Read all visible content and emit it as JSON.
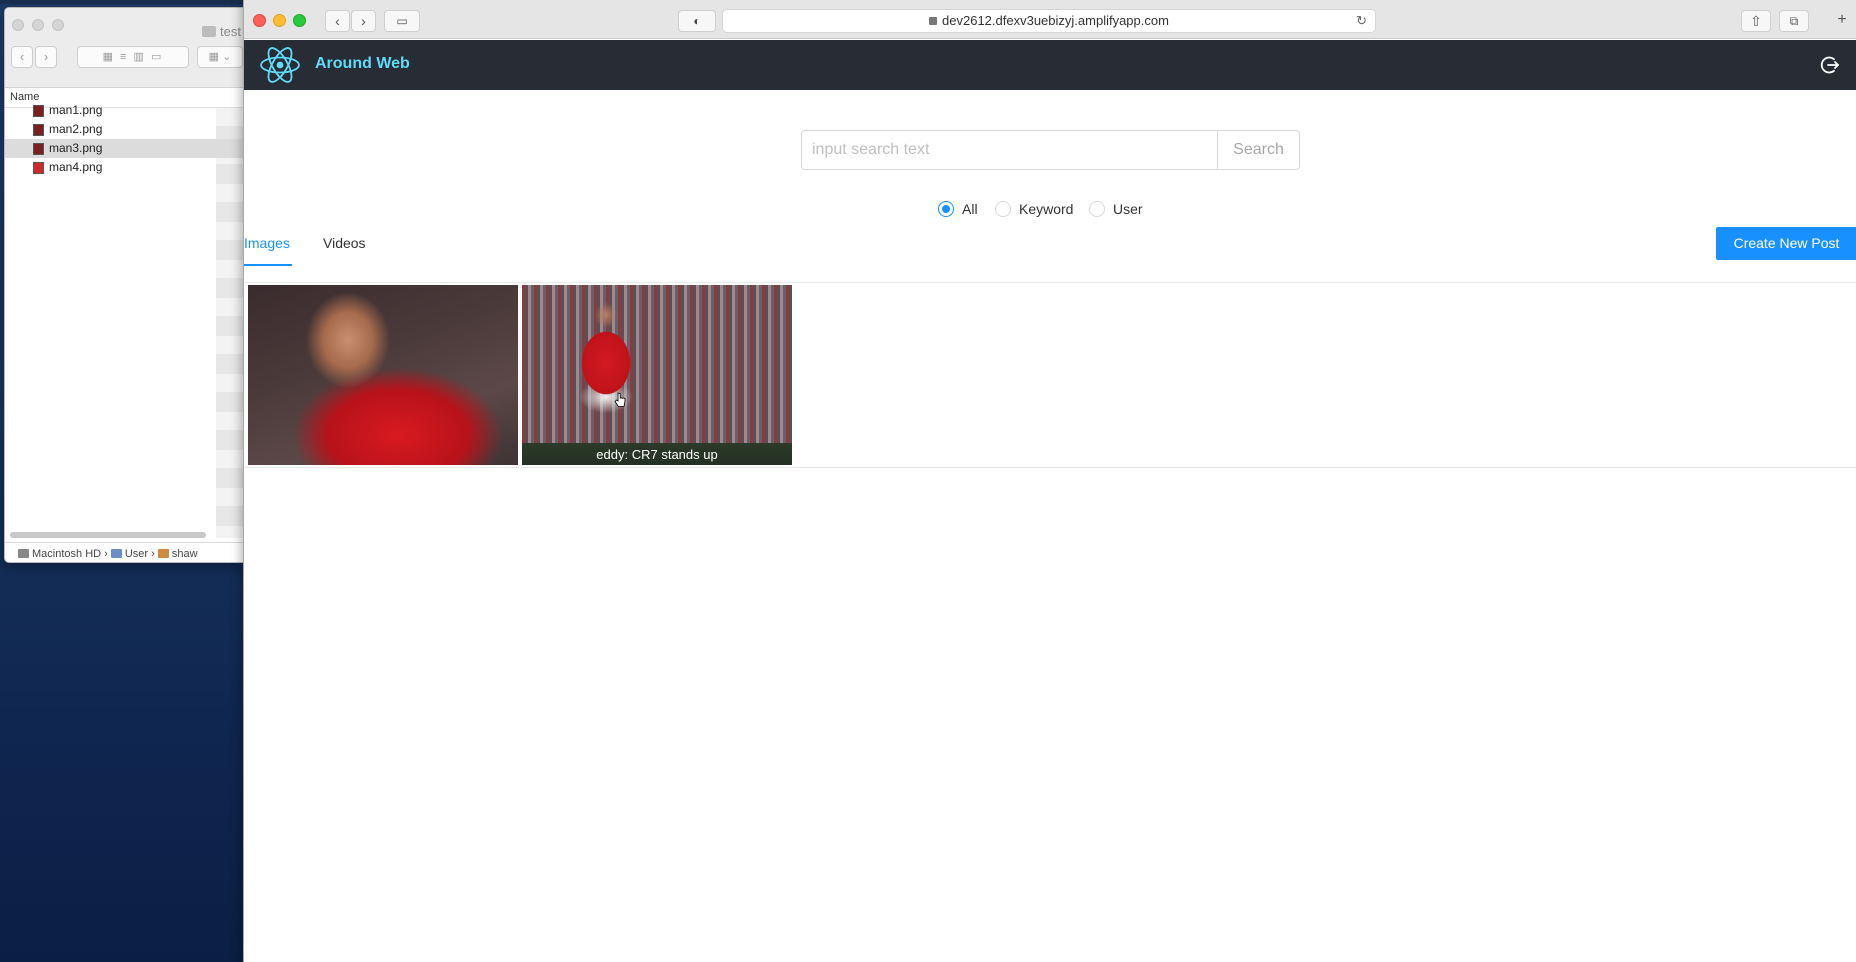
{
  "finder": {
    "title": "test",
    "column_header": "Name",
    "files": [
      {
        "name": "man1.png",
        "selected": false
      },
      {
        "name": "man2.png",
        "selected": false
      },
      {
        "name": "man3.png",
        "selected": true
      },
      {
        "name": "man4.png",
        "selected": false
      }
    ],
    "path": [
      "Macintosh HD",
      "User",
      "shaw"
    ]
  },
  "browser": {
    "url": "dev2612.dfexv3uebizyj.amplifyapp.com"
  },
  "app": {
    "title": "Around Web",
    "brand_color": "#61dafb",
    "header_color": "#282c34"
  },
  "search": {
    "placeholder": "input search text",
    "value": "",
    "button_label": "Search"
  },
  "search_type": {
    "options": [
      {
        "label": "All",
        "checked": true
      },
      {
        "label": "Keyword",
        "checked": false
      },
      {
        "label": "User",
        "checked": false
      }
    ],
    "accent_color": "#1890ff"
  },
  "tabs": [
    {
      "label": "Images",
      "active": true
    },
    {
      "label": "Videos",
      "active": false
    }
  ],
  "create_post_label": "Create New Post",
  "gallery": {
    "images": [
      {
        "caption": ""
      },
      {
        "caption": "eddy: CR7 stands up"
      }
    ]
  }
}
